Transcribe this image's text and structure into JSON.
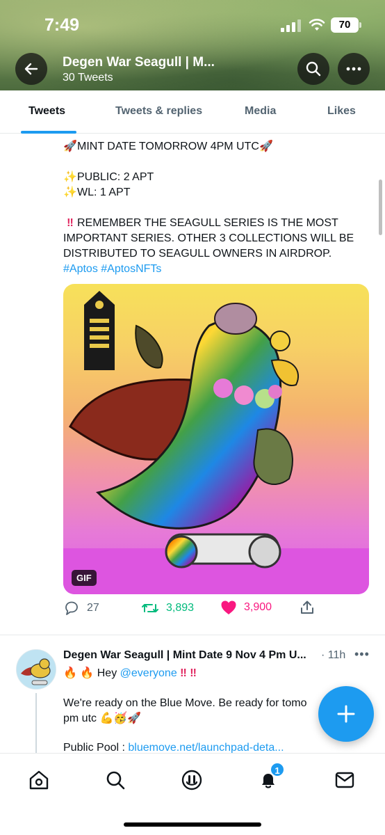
{
  "status_bar": {
    "time": "7:49",
    "battery": "70"
  },
  "header": {
    "title": "Degen War Seagull | M...",
    "subtitle": "30 Tweets"
  },
  "tabs": [
    {
      "label": "Tweets",
      "active": true
    },
    {
      "label": "Tweets & replies",
      "active": false
    },
    {
      "label": "Media",
      "active": false
    },
    {
      "label": "Likes",
      "active": false
    }
  ],
  "tweet1": {
    "line_mint": "MINT DATE TOMORROW 4PM UTC",
    "line_public": "PUBLIC: 2 APT",
    "line_wl": "WL: 1 APT",
    "line_remember": "REMEMBER THE SEAGULL SERIES IS THE MOST IMPORTANT SERIES. OTHER 3 COLLECTIONS WILL BE DISTRIBUTED TO SEAGULL OWNERS IN AIRDROP.",
    "hashtags": "#Aptos #AptosNFTs",
    "media_badge": "GIF",
    "replies": "27",
    "retweets": "3,893",
    "likes": "3,900"
  },
  "tweet2": {
    "author": "Degen War Seagull | Mint Date 9 Nov 4 Pm U...",
    "time": "· 11h",
    "more": "•••",
    "hey": "Hey",
    "mention": "@everyone",
    "body": "We're ready on the Blue Move. Be ready for tomo pm utc",
    "pool_label": "Public Pool :",
    "pool_link": "bluemove.net/launchpad-deta..."
  },
  "nav": {
    "notifications_badge": "1"
  },
  "colors": {
    "accent": "#1d9bf0",
    "retweet": "#00ba7c",
    "like": "#f91880"
  }
}
